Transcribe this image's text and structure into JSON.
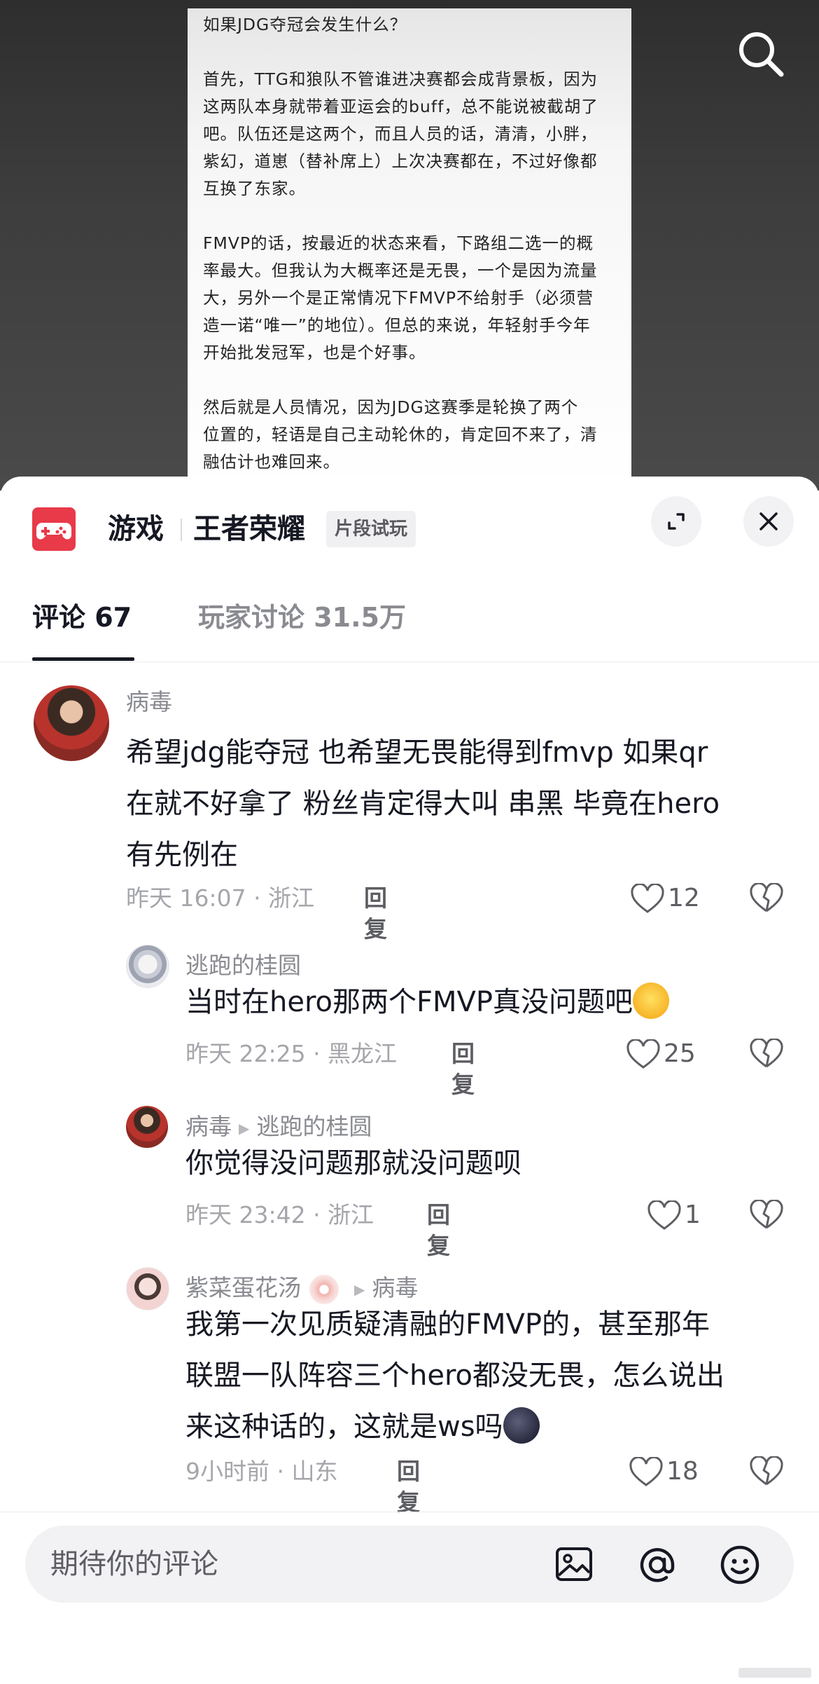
{
  "article": {
    "lines": [
      "如果JDG夺冠会发生什么？",
      "首先，TTG和狼队不管谁进决赛都会成背景板，因为",
      "这两队本身就带着亚运会的buff，总不能说被截胡了",
      "吧。队伍还是这两个，而且人员的话，清清，小胖，",
      "紫幻，道崽（替补席上）上次决赛都在，不过好像都",
      "互换了东家。",
      "FMVP的话，按最近的状态来看，下路组二选一的概",
      "率最大。但我认为大概率还是无畏，一个是因为流量",
      "大，另外一个是正常情况下FMVP不给射手（必须营",
      "造一诺“唯一”的地位）。但总的来说，年轻射手今年",
      "开始批发冠军，也是个好事。",
      "然后就是人员情况，因为JDG这赛季是轮换了两个",
      "位置的，轻语是自己主动轮休的，肯定回不来了，清",
      "融估计也难回来。"
    ]
  },
  "header": {
    "category": "游戏",
    "game_name": "王者荣耀",
    "trial_badge": "片段试玩",
    "icons": {
      "game": "game-controller-icon",
      "expand": "expand-icon",
      "close": "close-icon",
      "search": "search-icon"
    },
    "accent_color": "#e83a48"
  },
  "tabs": [
    {
      "label": "评论 67",
      "active": true
    },
    {
      "label": "玩家讨论 31.5万",
      "active": false
    }
  ],
  "comments": [
    {
      "author": "病毒",
      "text_lines": [
        "希望jdg能夺冠 也希望无畏能得到fmvp 如果qr",
        "在就不好拿了 粉丝肯定得大叫 串黑 毕竟在hero",
        "有先例在"
      ],
      "meta": "昨天 16:07 · 浙江",
      "reply": "回复",
      "likes": "12"
    },
    {
      "author": "逃跑的桂圆",
      "text": "当时在hero那两个FMVP真没问题吧",
      "emoji": "astonished-face-emoji",
      "meta": "昨天 22:25 · 黑龙江",
      "reply": "回复",
      "likes": "25"
    },
    {
      "author": "病毒",
      "reply_to": "逃跑的桂圆",
      "text": "你觉得没问题那就没问题呗",
      "meta": "昨天 23:42 · 浙江",
      "reply": "回复",
      "likes": "1"
    },
    {
      "author": "紫菜蛋花汤",
      "reply_to": "病毒",
      "text_lines": [
        "我第一次见质疑清融的FMVP的，甚至那年",
        "联盟一队阵容三个hero都没无畏，怎么说出",
        "来这种话的，这就是ws吗"
      ],
      "emoji": "new-moon-face-emoji",
      "meta": "9小时前 · 山东",
      "reply": "回复",
      "likes": "18"
    }
  ],
  "input": {
    "placeholder": "期待你的评论",
    "icons": [
      "image-icon",
      "at-icon",
      "emoji-icon"
    ]
  }
}
